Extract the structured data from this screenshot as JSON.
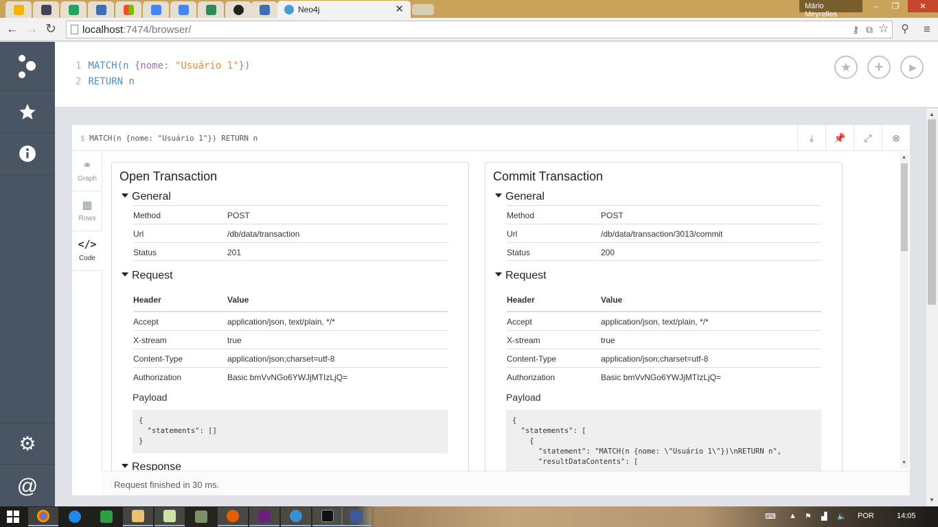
{
  "browser": {
    "active_tab_title": "Neo4j",
    "user_name": "Mário Meyrelles",
    "url_host": "localhost",
    "url_rest": ":7474/browser/"
  },
  "sidebar": {
    "items": [
      "neo4j-logo",
      "favorites",
      "info",
      "settings",
      "about"
    ]
  },
  "editor": {
    "line1_num": "1",
    "line2_num": "2",
    "line1_kw": "MATCH",
    "line1_paren": "(n ",
    "line1_brace_open": "{",
    "line1_prop": "nome",
    "line1_colon": ": ",
    "line1_str": "\"Usuário 1\"",
    "line1_close": "})",
    "line2_kw": "RETURN",
    "line2_var": " n"
  },
  "frame": {
    "query": "MATCH(n {nome: \"Usuário 1\"}) RETURN n",
    "prompt": "$",
    "views": [
      {
        "label": "Graph"
      },
      {
        "label": "Rows"
      },
      {
        "label": "Code"
      }
    ],
    "status": "Request finished in 30 ms."
  },
  "open_tx": {
    "title": "Open Transaction",
    "general_label": "General",
    "method_key": "Method",
    "method_val": "POST",
    "url_key": "Url",
    "url_val": "/db/data/transaction",
    "status_key": "Status",
    "status_val": "201",
    "request_label": "Request",
    "header_col": "Header",
    "value_col": "Value",
    "headers": [
      {
        "k": "Accept",
        "v": "application/json, text/plain, */*"
      },
      {
        "k": "X-stream",
        "v": "true"
      },
      {
        "k": "Content-Type",
        "v": "application/json;charset=utf-8"
      },
      {
        "k": "Authorization",
        "v": "Basic bmVvNGo6YWJjMTIzLjQ="
      }
    ],
    "payload_label": "Payload",
    "payload": "{\n  \"statements\": []\n}",
    "response_label": "Response"
  },
  "commit_tx": {
    "title": "Commit Transaction",
    "general_label": "General",
    "method_key": "Method",
    "method_val": "POST",
    "url_key": "Url",
    "url_val": "/db/data/transaction/3013/commit",
    "status_key": "Status",
    "status_val": "200",
    "request_label": "Request",
    "header_col": "Header",
    "value_col": "Value",
    "headers": [
      {
        "k": "Accept",
        "v": "application/json, text/plain, */*"
      },
      {
        "k": "X-stream",
        "v": "true"
      },
      {
        "k": "Content-Type",
        "v": "application/json;charset=utf-8"
      },
      {
        "k": "Authorization",
        "v": "Basic bmVvNGo6YWJjMTIzLjQ="
      }
    ],
    "payload_label": "Payload",
    "payload": "{\n  \"statements\": [\n    {\n      \"statement\": \"MATCH(n {nome: \\\"Usuário 1\\\"})\\nRETURN n\",\n      \"resultDataContents\": ["
  },
  "taskbar": {
    "language": "POR",
    "clock": "14:05"
  },
  "colors": {
    "sidebar_bg": "#4a5563",
    "keyword": "#4a90c2",
    "string": "#e2893a",
    "property": "#9d6fb5"
  }
}
